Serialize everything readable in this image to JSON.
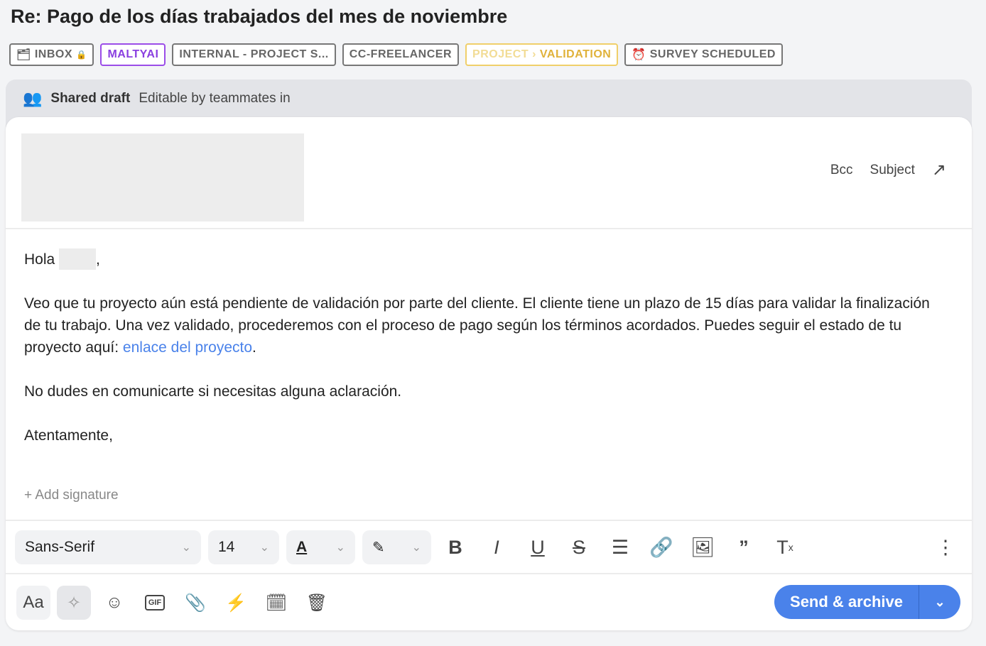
{
  "title": "Re: Pago de los días trabajados del mes de noviembre",
  "tags": [
    {
      "label": "INBOX",
      "icon": "inbox-icon",
      "suffix_icon": "lock-icon"
    },
    {
      "label": "MALTYAI",
      "color": "#8a3fe0"
    },
    {
      "label": "INTERNAL - PROJECT S..."
    },
    {
      "label": "CC-FREELANCER"
    },
    {
      "label_prefix": "PROJECT",
      "label": "VALIDATION",
      "color": "#e0b23a"
    },
    {
      "label": "SURVEY SCHEDULED",
      "icon": "alarm-clock-icon"
    }
  ],
  "shared": {
    "label": "Shared draft",
    "desc": "Editable by teammates in"
  },
  "header": {
    "bcc": "Bcc",
    "subject": "Subject"
  },
  "body": {
    "greeting": "Hola",
    "greeting_end": ",",
    "p1": "Veo que tu proyecto aún está pendiente de validación por parte del cliente. El cliente tiene un plazo de 15 días para validar la finalización de tu trabajo. Una vez validado, procederemos con el proceso de pago según los términos acordados. Puedes seguir el estado de tu proyecto aquí: ",
    "link": "enlace del proyecto",
    "p1_end": ".",
    "p2": "No dudes en comunicarte si necesitas alguna aclaración.",
    "p3": "Atentamente,"
  },
  "add_signature": "Add signature",
  "toolbar": {
    "font": "Sans-Serif",
    "size": "14"
  },
  "send": {
    "label": "Send & archive",
    "color": "#4a82ea"
  },
  "aa": "Aa"
}
